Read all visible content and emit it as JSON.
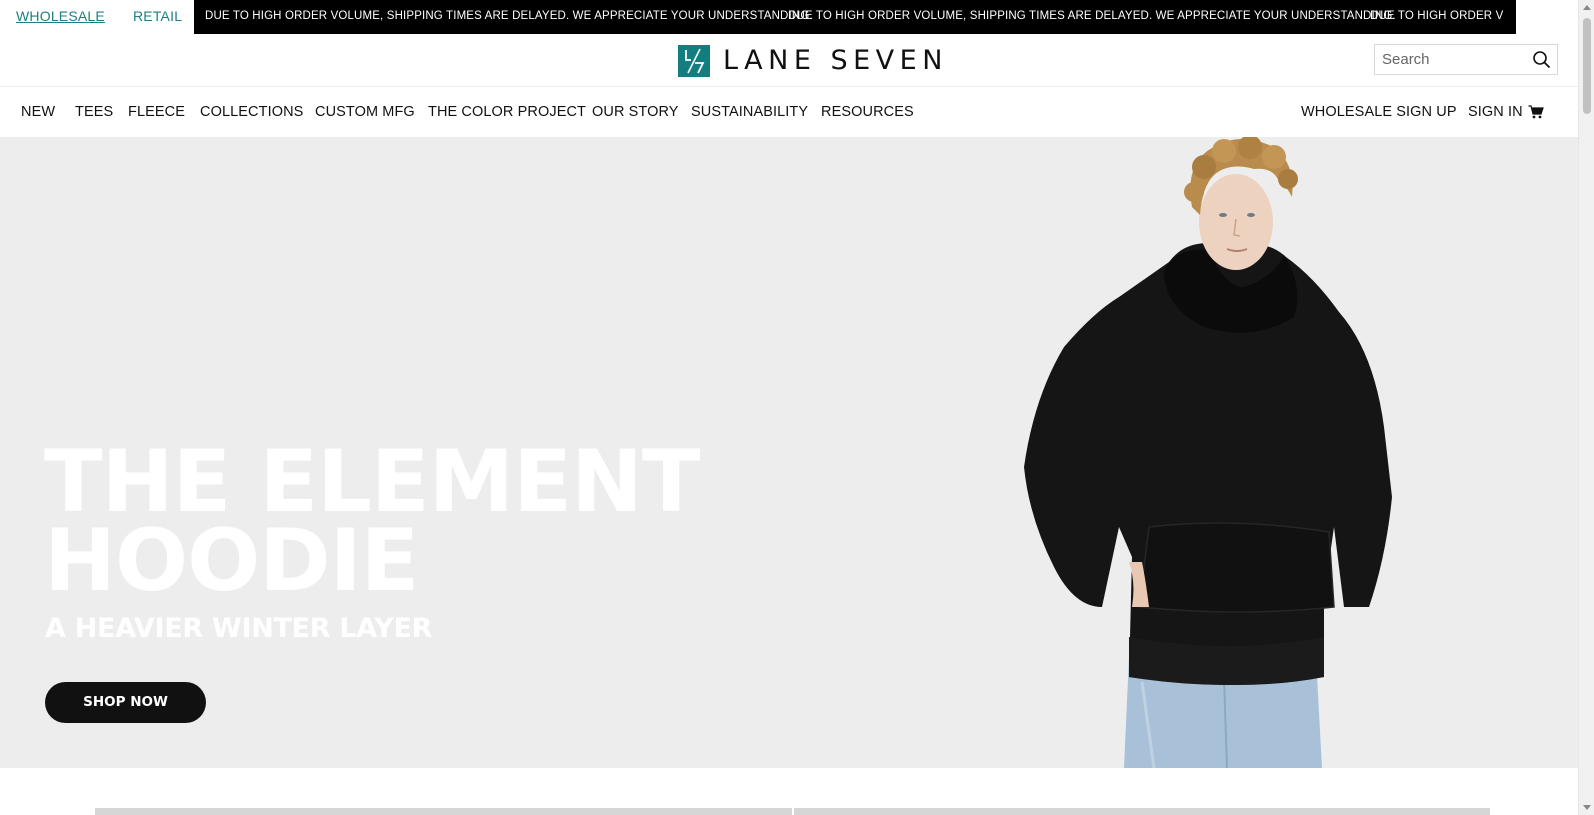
{
  "topbar": {
    "wholesale_label": "WHOLESALE",
    "retail_label": "RETAIL",
    "announcement": "DUE TO HIGH ORDER VOLUME, SHIPPING TIMES ARE DELAYED. WE APPRECIATE YOUR UNDERSTANDING.",
    "announcement_tail": "DUE TO HIGH ORDER V"
  },
  "header": {
    "logo_text": "LANE SEVEN",
    "logo_mark_text": "L/7",
    "search_placeholder": "Search"
  },
  "nav": {
    "items": [
      {
        "label": "NEW"
      },
      {
        "label": "TEES"
      },
      {
        "label": "FLEECE"
      },
      {
        "label": "COLLECTIONS"
      },
      {
        "label": "CUSTOM MFG"
      },
      {
        "label": "THE COLOR PROJECT"
      },
      {
        "label": "OUR STORY"
      },
      {
        "label": "SUSTAINABILITY"
      },
      {
        "label": "RESOURCES"
      }
    ],
    "wholesale_signup": "WHOLESALE SIGN UP",
    "sign_in": "SIGN IN",
    "cart_icon": "cart-icon"
  },
  "hero": {
    "title_line1": "THE ELEMENT",
    "title_line2": "HOODIE",
    "subtitle": "A HEAVIER WINTER LAYER",
    "cta_label": "SHOP NOW"
  },
  "colors": {
    "brand_teal": "#137d80",
    "link_teal": "#1d7f82",
    "ticker_bg": "#000000",
    "hero_bg": "#ededed",
    "button_bg": "#111111"
  }
}
